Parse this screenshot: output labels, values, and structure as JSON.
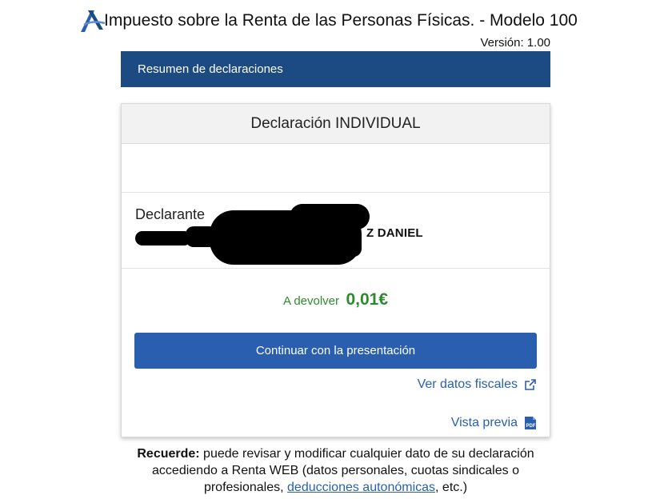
{
  "header": {
    "title": "Impuesto sobre la Renta de las Personas Físicas. - Modelo 100",
    "version": "Versión: 1.00",
    "logo": "aeat-logo"
  },
  "banner": {
    "label": "Resumen de declaraciones"
  },
  "card": {
    "title": "Declaración INDIVIDUAL",
    "declarant_label": "Declarante",
    "declarant_name_visible": "Z DANIEL",
    "refund_label": "A devolver",
    "refund_amount": "0,01€",
    "continue_button": "Continuar con la presentación",
    "fiscal_link": "Ver datos fiscales",
    "preview_link": "Vista previa"
  },
  "reminder": {
    "bold": "Recuerde:",
    "text": " puede revisar y modificar cualquier dato de su declaración accediendo a Renta WEB (datos personales, cuotas sindicales o profesionales, ",
    "link": "deducciones autonómicas",
    "tail": ", etc.)"
  },
  "colors": {
    "banner": "#1c4a82",
    "primary": "#2a5fb0",
    "refund": "#2e8a2e"
  },
  "icons": {
    "external_link": "external-link-icon",
    "pdf": "pdf-icon"
  }
}
